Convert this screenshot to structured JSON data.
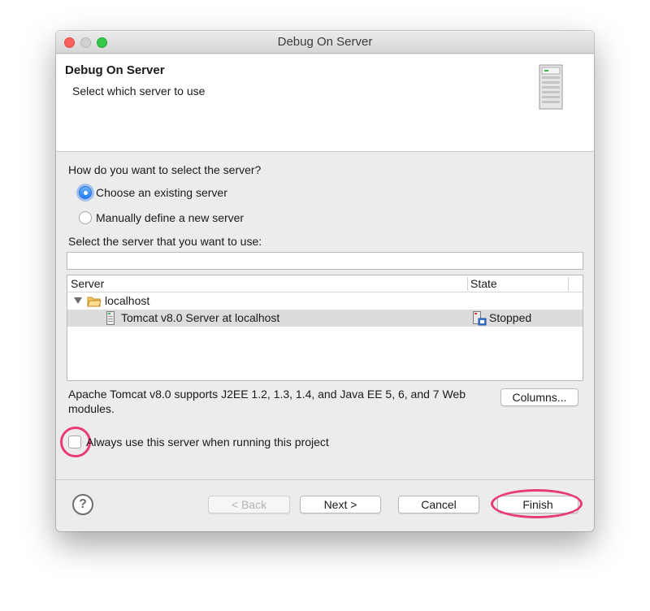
{
  "window": {
    "title": "Debug On Server",
    "controls": [
      "close",
      "minimize",
      "maximize"
    ]
  },
  "header": {
    "title": "Debug On Server",
    "subtitle": "Select which server to use",
    "icon": "server-tower-icon"
  },
  "selection": {
    "question": "How do you want to select the server?",
    "options": [
      {
        "label": "Choose an existing server",
        "selected": true
      },
      {
        "label": "Manually define a new server",
        "selected": false
      }
    ],
    "server_prompt": "Select the server that you want to use:",
    "filter_value": ""
  },
  "table": {
    "columns": [
      "Server",
      "State"
    ],
    "rows": [
      {
        "name": "localhost",
        "state": "",
        "type": "folder",
        "expanded": true
      },
      {
        "name": "Tomcat v8.0 Server at localhost",
        "state": "Stopped",
        "type": "server",
        "selected": true
      }
    ]
  },
  "description": "Apache Tomcat v8.0 supports J2EE 1.2, 1.3, 1.4, and Java EE 5, 6, and 7 Web modules.",
  "columns_button": "Columns...",
  "always_use": {
    "label": "Always use this server when running this project",
    "checked": false
  },
  "footer": {
    "help": "?",
    "back": "< Back",
    "next": "Next >",
    "cancel": "Cancel",
    "finish": "Finish"
  },
  "colors": {
    "highlight": "#e83a78",
    "accent": "#1f7df5"
  }
}
